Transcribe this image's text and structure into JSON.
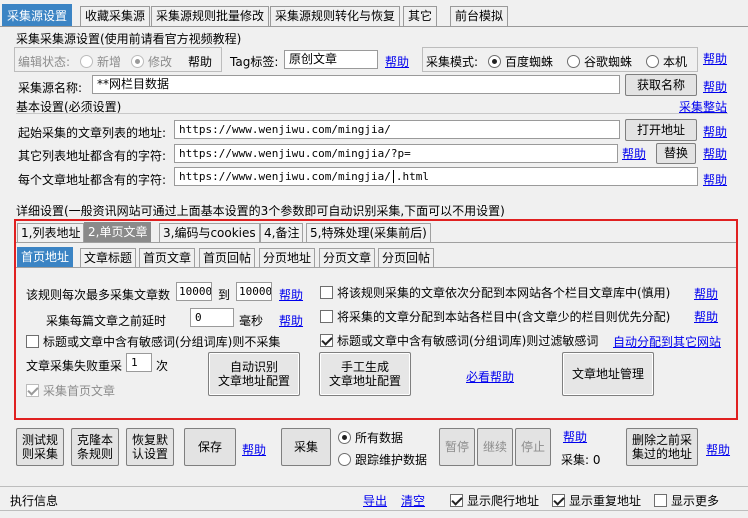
{
  "tabs": [
    "采集源设置",
    "收藏采集源",
    "采集源规则批量修改",
    "采集源规则转化与恢复",
    "其它",
    "前台模拟"
  ],
  "header_section": {
    "title": "采集采集源设置(使用前请看官方视频教程)",
    "edit_state_label": "编辑状态:",
    "opt_new": "新增",
    "opt_modify": "修改",
    "help": "帮助",
    "tag_label": "Tag标签:",
    "tag_value": "原创文章",
    "mode_label": "采集模式:",
    "mode_baidu": "百度蜘蛛",
    "mode_google": "谷歌蜘蛛",
    "mode_local": "本机"
  },
  "source": {
    "name_label": "采集源名称:",
    "name_value": "**网栏目数据",
    "get_name_btn": "获取名称",
    "help": "帮助"
  },
  "basic": {
    "title": "基本设置(必须设置)",
    "collect_link": "采集整站",
    "start_label": "起始采集的文章列表的地址:",
    "start_value": "https://www.wenjiwu.com/mingjia/",
    "open_btn": "打开地址",
    "other_label": "其它列表地址都含有的字符:",
    "other_value": "https://www.wenjiwu.com/mingjia/?p=",
    "replace_btn": "替换",
    "each_label": "每个文章地址都含有的字符:",
    "each_value_a": "https://www.wenjiwu.com/mingjia/",
    "each_value_b": ".html",
    "help": "帮助"
  },
  "detail_title": "详细设置(一般资讯网站可通过上面基本设置的3个参数即可自动识别采集,下面可以不用设置)",
  "detail_tabs": [
    "1,列表地址",
    "2,单页文章",
    "3,编码与cookies",
    "4,备注",
    "5,特殊处理(采集前后)"
  ],
  "page_tabs": [
    "首页地址",
    "文章标题",
    "首页文章",
    "首页回帖",
    "分页地址",
    "分页文章",
    "分页回帖"
  ],
  "first_page": {
    "max_label": "该规则每次最多采集文章数",
    "max_from": "10000",
    "to": "到",
    "max_to": "10000",
    "delay_label": "采集每篇文章之前延时",
    "delay_value": "0",
    "ms": "毫秒",
    "sens_skip": "标题或文章中含有敏感词(分组词库)则不采集",
    "retry_label": "文章采集失败重采",
    "retry_value": "1",
    "retry_unit": "次",
    "first_article": "采集首页文章",
    "auto_btn": "自动识别\n文章地址配置",
    "manual_btn": "手工生成\n文章地址配置",
    "must_help": "必看帮助",
    "manage_btn": "文章地址管理",
    "opt1": "将该规则采集的文章依次分配到本网站各个栏目文章库中(慎用)",
    "opt2": "将采集的文章分配到本站各栏目中(含文章少的栏目则优先分配)",
    "opt3": "标题或文章中含有敏感词(分组词库)则过滤敏感词",
    "auto_assign": "自动分配到其它网站",
    "help": "帮助"
  },
  "bottom": {
    "test_btn": "测试规\n则采集",
    "clone_btn": "克隆本\n条规则",
    "restore_btn": "恢复默\n认设置",
    "save_btn": "保存",
    "help": "帮助",
    "collect_btn": "采集",
    "all_data": "所有数据",
    "track_data": "跟踪维护数据",
    "pause_btn": "暂停",
    "continue_btn": "继续",
    "stop_btn": "停止",
    "collect_count": "采集: 0",
    "delete_btn": "删除之前采\n集过的地址"
  },
  "log": {
    "title": "执行信息",
    "export": "导出",
    "clear": "清空",
    "show_crawl": "显示爬行地址",
    "show_dup": "显示重复地址",
    "show_more": "显示更多"
  }
}
